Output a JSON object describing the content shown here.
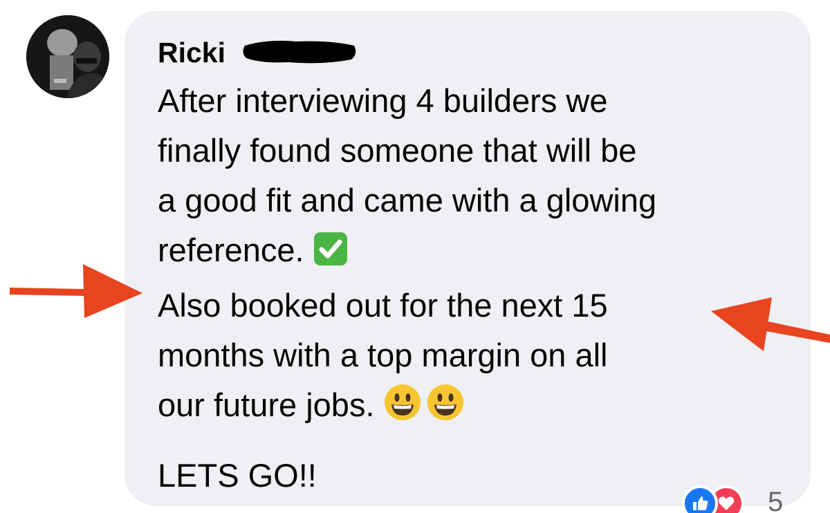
{
  "comment": {
    "author_name": "Ricki",
    "lines": [
      "After interviewing 4 builders we",
      "finally found someone that will be",
      "a good fit and came with a glowing",
      "reference.",
      "Also booked out for the next 15",
      "months with a top margin on all",
      "our future jobs.",
      "LETS GO!!"
    ],
    "emojis": {
      "check": "check-mark-emoji",
      "smile": "grinning-face-emoji"
    }
  },
  "reactions": {
    "icons": [
      "like-icon",
      "love-icon"
    ],
    "count": "5"
  },
  "colors": {
    "bubble": "#eff0f3",
    "text": "#050505",
    "arrow": "#e8441f",
    "check_green": "#4bb543",
    "like_blue": "#1877f2",
    "love_red": "#f33e58"
  }
}
